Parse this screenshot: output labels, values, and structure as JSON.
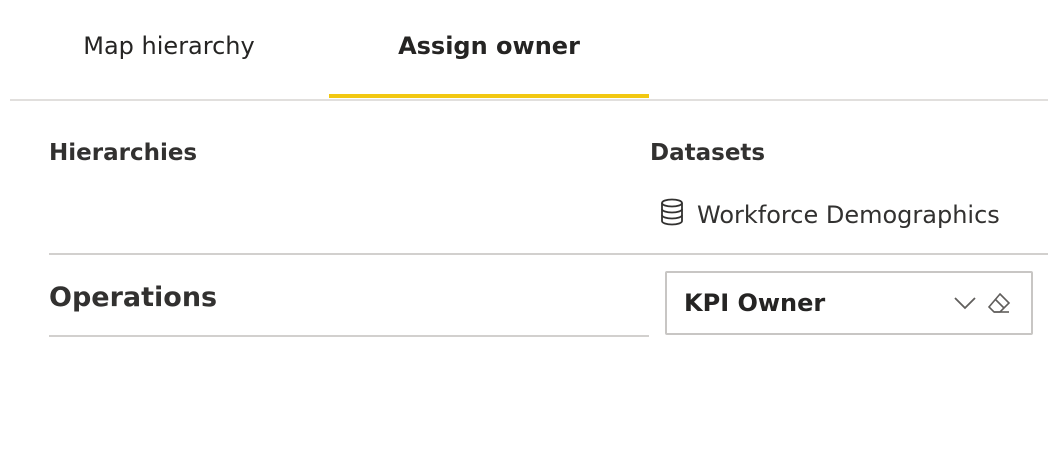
{
  "tabs": [
    {
      "label": "Map hierarchy",
      "selected": false
    },
    {
      "label": "Assign owner",
      "selected": true
    }
  ],
  "accent_color": "#f2c811",
  "columns": {
    "hierarchies_label": "Hierarchies",
    "datasets_label": "Datasets"
  },
  "dataset": {
    "icon": "database-icon",
    "name": "Workforce Demographics"
  },
  "rows": [
    {
      "hierarchy": "Operations",
      "owner_value": "KPI Owner",
      "icons": [
        "chevron-down-icon",
        "eraser-icon"
      ]
    }
  ]
}
